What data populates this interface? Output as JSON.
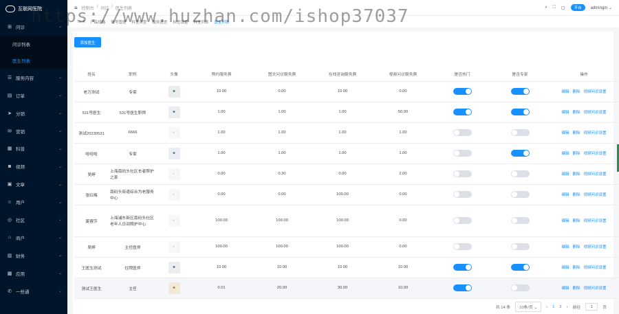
{
  "app": {
    "logo_text": "互联网医院"
  },
  "sidebar": {
    "items": [
      {
        "label": "问诊",
        "icon": "stethoscope-icon",
        "glyph": "⊞"
      },
      {
        "label": "服务内容",
        "icon": "list-icon",
        "glyph": "☰"
      },
      {
        "label": "订单",
        "icon": "order-icon",
        "glyph": "▤"
      },
      {
        "label": "分销",
        "icon": "share-icon",
        "glyph": "➤"
      },
      {
        "label": "营销",
        "icon": "gift-icon",
        "glyph": "✉"
      },
      {
        "label": "科普",
        "icon": "book-icon",
        "glyph": "▦"
      },
      {
        "label": "视频",
        "icon": "video-icon",
        "glyph": "◙"
      },
      {
        "label": "文章",
        "icon": "article-icon",
        "glyph": "▣"
      },
      {
        "label": "用户",
        "icon": "user-icon",
        "glyph": "☺"
      },
      {
        "label": "社区",
        "icon": "community-icon",
        "glyph": "◎"
      },
      {
        "label": "商户",
        "icon": "shop-icon",
        "glyph": "⌂"
      },
      {
        "label": "财务",
        "icon": "finance-icon",
        "glyph": "▥"
      },
      {
        "label": "应用",
        "icon": "apps-icon",
        "glyph": "▩"
      },
      {
        "label": "一些通",
        "icon": "phone-icon",
        "glyph": "✆"
      }
    ],
    "sub_items": [
      "问诊列表",
      "医生列表"
    ]
  },
  "header": {
    "breadcrumbs": [
      "控制台",
      "问诊",
      "医生列表"
    ],
    "platform_badge": "平台",
    "username": "admingm"
  },
  "tabs": [
    "Ta-A",
    "产品规格",
    "账号管理",
    "科室类型",
    "服务语言",
    "标签设置",
    "科室列表",
    "医生列表"
  ],
  "page": {
    "add_button": "添加医生"
  },
  "table": {
    "headers": [
      "姓名",
      "职称",
      "头像",
      "预约服务费",
      "图文问诊服务费",
      "在线咨询服务费",
      "视频问诊服务费",
      "是否热门",
      "是否专家",
      "操作"
    ],
    "op_labels": [
      "编辑",
      "删除",
      "视频问诊设置"
    ],
    "rows": [
      {
        "name": "老万测试",
        "title": "专家",
        "avatar": "doctor",
        "fee1": "10.00",
        "fee2": "0.00",
        "fee3": "10.00",
        "fee4": "0.00",
        "hot": true,
        "expert": true
      },
      {
        "name": "531号医生",
        "title": "531号医生职称",
        "avatar": "photo",
        "fee1": "1.00",
        "fee2": "1.00",
        "fee3": "1.00",
        "fee4": "50.00",
        "hot": true,
        "expert": true
      },
      {
        "name": "测试20230531",
        "title": "6666",
        "avatar": "none",
        "fee1": "1.00",
        "fee2": "1.00",
        "fee3": "1.00",
        "fee4": "1.00",
        "hot": false,
        "expert": false
      },
      {
        "name": "哈哈哈",
        "title": "专家",
        "avatar": "photo",
        "fee1": "1.00",
        "fee2": "1.00",
        "fee3": "1.00",
        "fee4": "1.00",
        "hot": false,
        "expert": true
      },
      {
        "name": "吴婷",
        "title": "上海南码头社区长者照护之家",
        "avatar": "none",
        "fee1": "0.00",
        "fee2": "0.30",
        "fee3": "0.00",
        "fee4": "2.00",
        "hot": false,
        "expert": false
      },
      {
        "name": "张红梅",
        "title": "南码头街道综合为老服务中心",
        "avatar": "none",
        "fee1": "0.00",
        "fee2": "0.00",
        "fee3": "100.00",
        "fee4": "0.00",
        "hot": false,
        "expert": false
      },
      {
        "name": "姜蓉莎",
        "title": "上海浦东新区南码头社区老年人日间照护中心",
        "avatar": "none",
        "fee1": "100.00",
        "fee2": "100.00",
        "fee3": "100.00",
        "fee4": "0.00",
        "hot": false,
        "expert": false
      },
      {
        "name": "吴婷",
        "title": "主任医师",
        "avatar": "none",
        "fee1": "100.00",
        "fee2": "100.00",
        "fee3": "100.00",
        "fee4": "0.00",
        "hot": false,
        "expert": false
      },
      {
        "name": "王医生测试",
        "title": "住院医师",
        "avatar": "doctor2",
        "fee1": "10.00",
        "fee2": "10.00",
        "fee3": "10.00",
        "fee4": "10.00",
        "hot": true,
        "expert": true
      },
      {
        "name": "测试王医生",
        "title": "主任",
        "avatar": "doctor3",
        "fee1": "0.01",
        "fee2": "20.00",
        "fee3": "30.00",
        "fee4": "10.00",
        "hot": true,
        "expert": false
      }
    ]
  },
  "pagination": {
    "total": "共 14 条",
    "page_size": "10条/页",
    "pages": [
      "1",
      "2"
    ],
    "goto_label": "前往",
    "goto_value": "1",
    "goto_suffix": "页"
  },
  "watermark": "https://www.huzhan.com/ishop37037",
  "colors": {
    "accent": "#1890ff",
    "sidebar_bg": "#001529"
  }
}
